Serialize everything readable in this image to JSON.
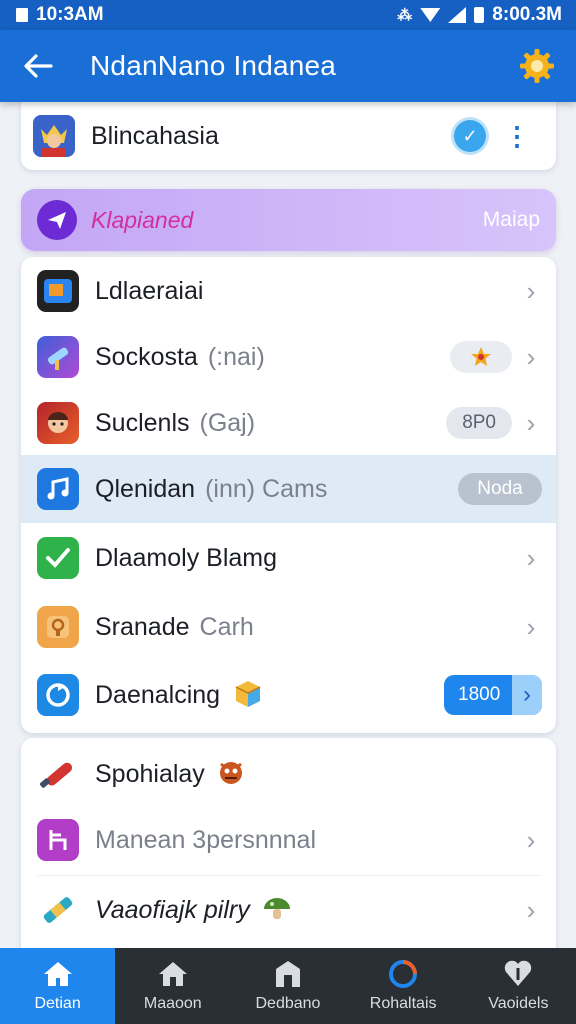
{
  "status_bar": {
    "time": "10:3AM",
    "right_time": "8:00.3M"
  },
  "app_bar": {
    "title": "NdanNano Indanea"
  },
  "top_item": {
    "title": "Blincahasia"
  },
  "promo": {
    "label": "Klapianed",
    "action": "Maiap"
  },
  "list": [
    {
      "title": "Ldlaeraiai",
      "subtitle": "",
      "trailing": "chevron"
    },
    {
      "title": "Sockosta",
      "subtitle": "(:nai)",
      "trailing": "badge-chevron"
    },
    {
      "title": "Suclenls",
      "subtitle": "(Gaj)",
      "pill": "8P0",
      "trailing": "pill-chevron"
    },
    {
      "title": "Qlenidan",
      "subtitle": "(inn) Cams",
      "pill": "Noda",
      "trailing": "pill"
    },
    {
      "title": "Dlaamoly Blamg",
      "subtitle": "",
      "trailing": "chevron"
    },
    {
      "title": "Sranade",
      "subtitle": "Carh",
      "trailing": "chevron"
    },
    {
      "title": "Daenalcing",
      "subtitle": "",
      "pill": "1800",
      "trailing": "pill-blue"
    }
  ],
  "bottom_list": [
    {
      "title": "Spohialay",
      "subtitle": ""
    },
    {
      "title": "Manean 3persnnnal",
      "subtitle": ""
    },
    {
      "title": "Vaaofiajk pilry",
      "subtitle": ""
    }
  ],
  "bottom_nav": [
    {
      "label": "Detian",
      "icon": "home-icon",
      "active": true
    },
    {
      "label": "Maaoon",
      "icon": "house-icon",
      "active": false
    },
    {
      "label": "Dedbano",
      "icon": "building-icon",
      "active": false
    },
    {
      "label": "Rohaltais",
      "icon": "refresh-icon",
      "active": false
    },
    {
      "label": "Vaoidels",
      "icon": "heart-icon",
      "active": false
    }
  ],
  "colors": {
    "primary": "#1a6fd6",
    "status_bar": "#1560c2",
    "promo": "#c3a6f5",
    "nav_bg": "#2a2e35",
    "nav_active": "#1f86ee"
  }
}
